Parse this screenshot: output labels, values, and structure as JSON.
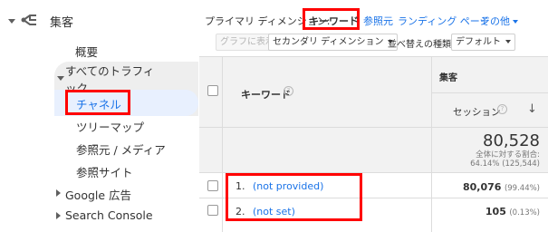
{
  "nav": {
    "section": "集客",
    "items": {
      "overview": "概要",
      "all_traffic_line1": "すべてのトラフィ",
      "all_traffic_line2": "ック",
      "channels": "チャネル",
      "treemap": "ツリーマップ",
      "source_medium": "参照元 / メディア",
      "referrals": "参照サイト",
      "google_ads": "Google 広告",
      "search_console": "Search Console"
    }
  },
  "tabs": {
    "primary_label": "プライマリ ディメンション:",
    "keyword": "キーワード",
    "source": "参照元",
    "landing_page": "ランディング ページ",
    "other": "その他"
  },
  "toolbar": {
    "graph_button": "グラフに表示",
    "secondary_dimension": "セカンダリ ディメンション",
    "sort_type_label": "並べ替えの種類:",
    "sort_type_value": "デフォルト"
  },
  "table": {
    "group_header": "集客",
    "keyword_header": "キーワード",
    "sessions_header": "セッション",
    "sort_arrow": "↓",
    "help_glyph": "?",
    "total": {
      "value": "80,528",
      "pct_label": "全体に対する割合:",
      "pct_detail": "64.14% (125,544)"
    },
    "rows": [
      {
        "index": "1.",
        "keyword": "(not provided)",
        "sessions": "80,076",
        "pct": "(99.44%)"
      },
      {
        "index": "2.",
        "keyword": "(not set)",
        "sessions": "105",
        "pct": "(0.13%)"
      }
    ]
  },
  "colors": {
    "highlight_red": "#ff0000",
    "link_blue": "#1a73e8",
    "active_nav_bg": "#e8f0fe"
  },
  "icons": {
    "nav_section": "acquisition-icon",
    "collapse": "caret-down-icon",
    "expand": "caret-right-icon",
    "help": "help-icon",
    "sort": "sort-desc-arrow"
  }
}
